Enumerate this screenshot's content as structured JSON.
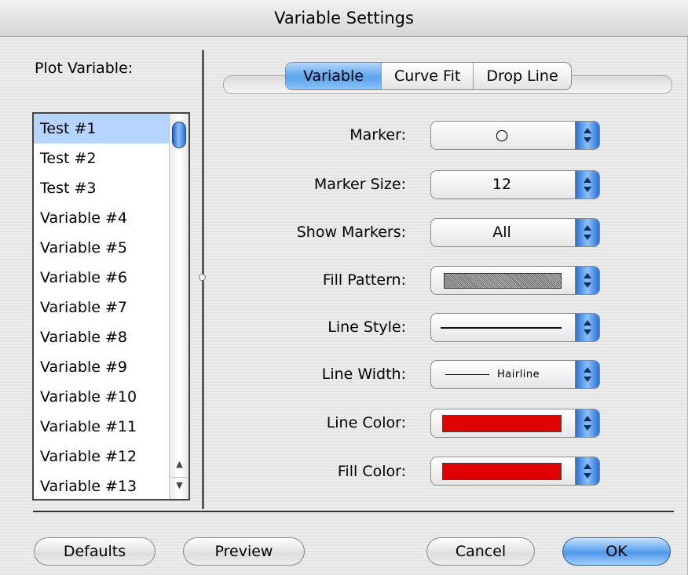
{
  "window": {
    "title": "Variable Settings"
  },
  "plot_variable": {
    "label": "Plot Variable:",
    "selected_index": 0,
    "items": [
      "Test #1",
      "Test #2",
      "Test #3",
      "Variable #4",
      "Variable #5",
      "Variable #6",
      "Variable #7",
      "Variable #8",
      "Variable #9",
      "Variable #10",
      "Variable #11",
      "Variable #12",
      "Variable #13"
    ]
  },
  "tabs": [
    {
      "label": "Variable",
      "active": true
    },
    {
      "label": "Curve Fit",
      "active": false
    },
    {
      "label": "Drop Line",
      "active": false
    }
  ],
  "fields": {
    "marker": {
      "label": "Marker:",
      "value": "○"
    },
    "marker_size": {
      "label": "Marker Size:",
      "value": "12"
    },
    "show_markers": {
      "label": "Show Markers:",
      "value": "All"
    },
    "fill_pattern": {
      "label": "Fill Pattern:"
    },
    "line_style": {
      "label": "Line Style:"
    },
    "line_width": {
      "label": "Line Width:",
      "value": "Hairline"
    },
    "line_color": {
      "label": "Line Color:",
      "color": "#e00000"
    },
    "fill_color": {
      "label": "Fill Color:",
      "color": "#e00000"
    }
  },
  "buttons": {
    "defaults": "Defaults",
    "preview": "Preview",
    "cancel": "Cancel",
    "ok": "OK"
  }
}
